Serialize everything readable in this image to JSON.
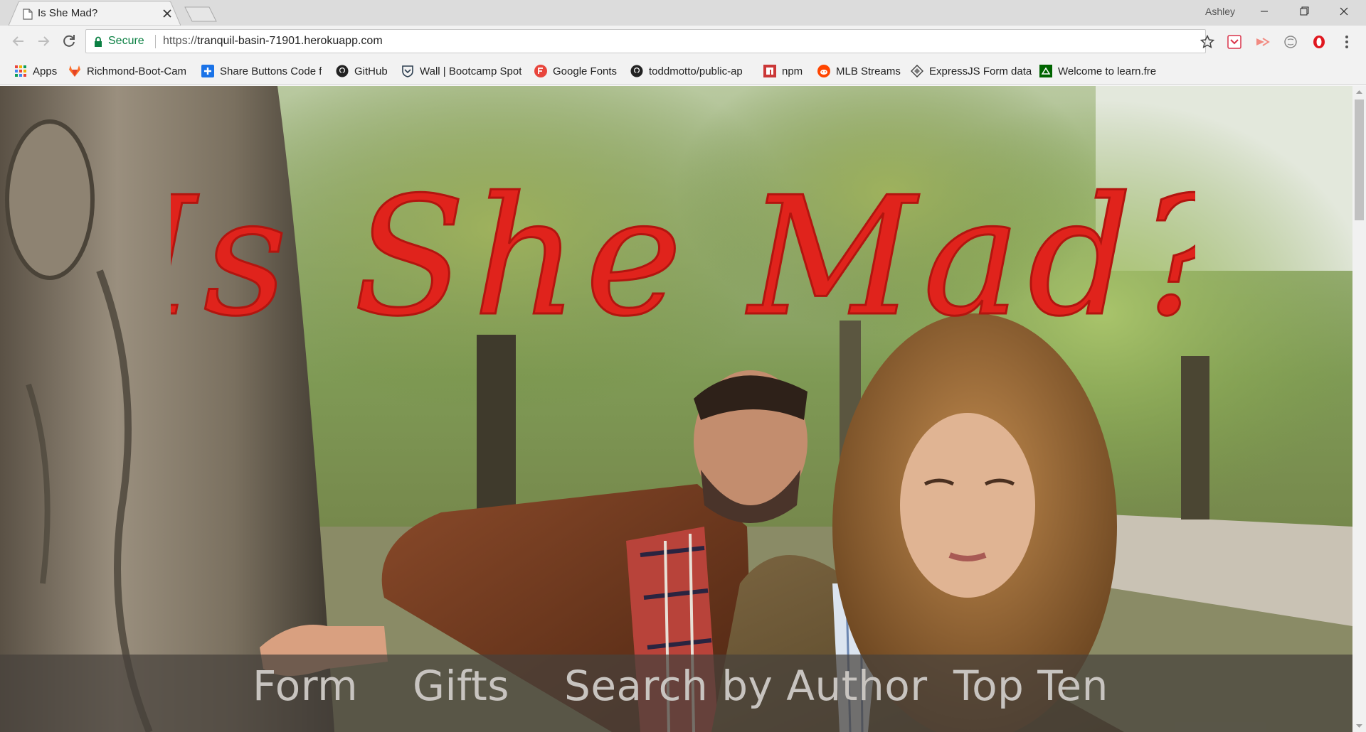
{
  "browser": {
    "tab": {
      "title": "Is She Mad?",
      "favicon": "page-icon"
    },
    "profile_name": "Ashley",
    "omnibox": {
      "secure_label": "Secure",
      "url_scheme": "https://",
      "url_host": "tranquil-basin-71901.herokuapp.com"
    },
    "bookmarks": [
      {
        "label": "Apps",
        "icon": "apps-grid-icon"
      },
      {
        "label": "Richmond-Boot-Cam",
        "icon": "gitlab-icon"
      },
      {
        "label": "Share Buttons Code f",
        "icon": "plus-square-icon"
      },
      {
        "label": "GitHub",
        "icon": "github-icon"
      },
      {
        "label": "Wall | Bootcamp Spot",
        "icon": "shield-icon"
      },
      {
        "label": "Google Fonts",
        "icon": "google-fonts-icon"
      },
      {
        "label": "toddmotto/public-ap",
        "icon": "github-icon"
      },
      {
        "label": "npm",
        "icon": "npm-icon"
      },
      {
        "label": "MLB Streams",
        "icon": "reddit-icon"
      },
      {
        "label": "ExpressJS Form data",
        "icon": "diamond-icon"
      },
      {
        "label": "Welcome to learn.fre",
        "icon": "freecodecamp-icon"
      }
    ],
    "colors": {
      "secure": "#0b8043",
      "tabstrip": "#dcdcdc",
      "toolbar": "#f2f2f2"
    }
  },
  "page": {
    "title": "Is She Mad?",
    "title_color": "#e0231c",
    "nav": {
      "form": "Form",
      "gifts": "Gifts",
      "search_by_author": "Search by Author",
      "top_ten": "Top Ten"
    }
  }
}
